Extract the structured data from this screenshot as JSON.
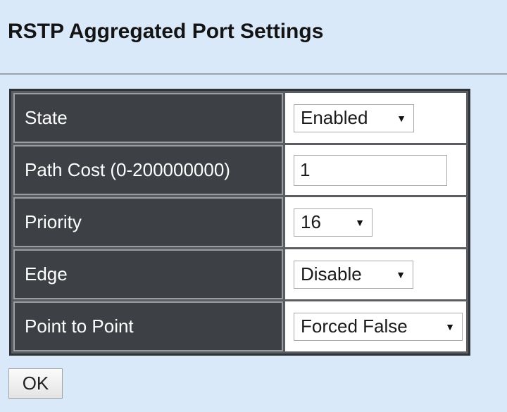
{
  "page": {
    "title": "RSTP Aggregated Port Settings"
  },
  "settings": [
    {
      "label": "State",
      "control": "select",
      "value": "Enabled"
    },
    {
      "label": "Path Cost (0-200000000)",
      "control": "input",
      "value": "1"
    },
    {
      "label": "Priority",
      "control": "select",
      "value": "16"
    },
    {
      "label": "Edge",
      "control": "select",
      "value": "Disable"
    },
    {
      "label": "Point to Point",
      "control": "select",
      "value": "Forced False"
    }
  ],
  "actions": {
    "ok_label": "OK"
  },
  "icons": {
    "dropdown_arrow": "▼"
  },
  "colors": {
    "page_background": "#d9e9fa",
    "label_cell_background": "#3d4044",
    "label_text": "#ffffff"
  }
}
